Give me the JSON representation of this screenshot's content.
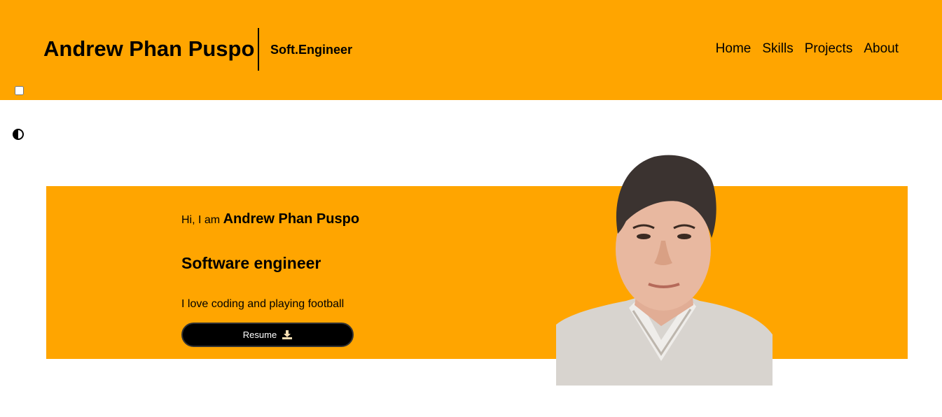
{
  "header": {
    "brand_name": "Andrew Phan Puspo",
    "brand_role": "Soft.Engineer",
    "nav": [
      {
        "label": "Home"
      },
      {
        "label": "Skills"
      },
      {
        "label": "Projects"
      },
      {
        "label": "About"
      }
    ]
  },
  "controls": {
    "menu_checkbox_checked": false,
    "theme_icon": "contrast-icon"
  },
  "hero": {
    "greeting_prefix": "Hi, I am",
    "name": "Andrew Phan Puspo",
    "title": "Software engineer",
    "bio": "I love coding and playing football",
    "resume_label": "Resume",
    "resume_icon": "download-icon"
  },
  "colors": {
    "accent": "#ffa500",
    "button_bg": "#000000",
    "button_text": "#ffffff"
  }
}
